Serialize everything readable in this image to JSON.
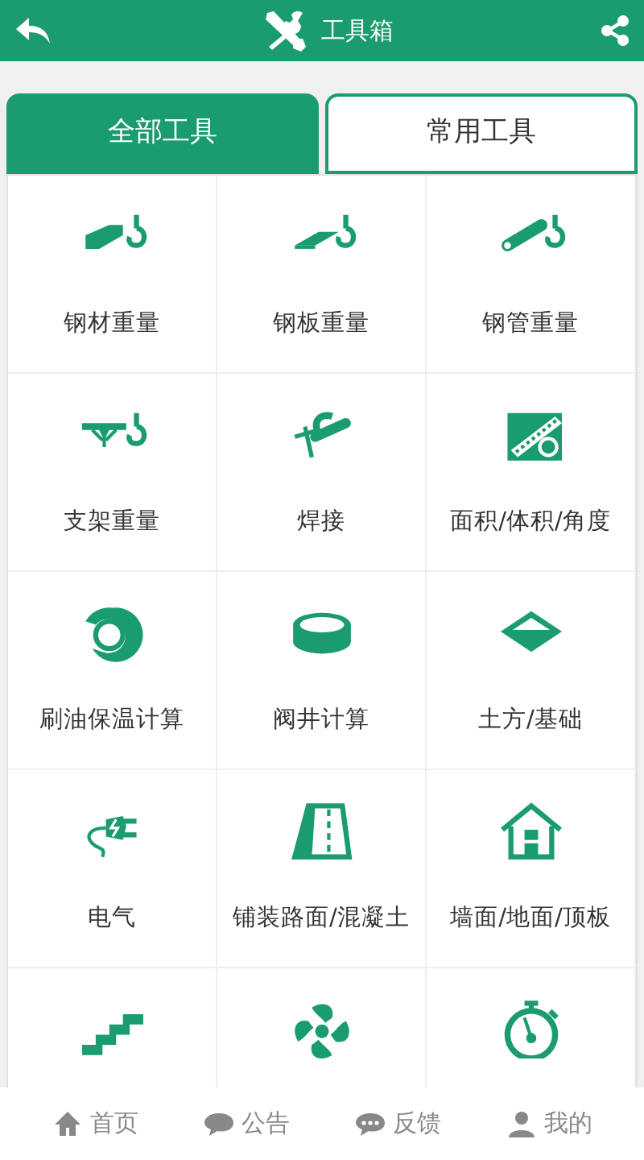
{
  "header": {
    "title": "工具箱"
  },
  "tabs": [
    {
      "label": "全部工具",
      "selected": true
    },
    {
      "label": "常用工具",
      "selected": false
    }
  ],
  "tools": [
    {
      "kind": "tool",
      "label": "钢材重量"
    },
    {
      "kind": "tool",
      "label": "钢板重量"
    },
    {
      "kind": "tool",
      "label": "钢管重量"
    },
    {
      "kind": "tool",
      "label": "支架重量"
    },
    {
      "kind": "tool",
      "label": "焊接"
    },
    {
      "kind": "tool",
      "label": "面积/体积/角度"
    },
    {
      "kind": "tool",
      "label": "刷油保温计算"
    },
    {
      "kind": "tool",
      "label": "阀井计算"
    },
    {
      "kind": "tool",
      "label": "土方/基础"
    },
    {
      "kind": "tool",
      "label": "电气"
    },
    {
      "kind": "tool",
      "label": "铺装路面/混凝土"
    },
    {
      "kind": "tool",
      "label": "墙面/地面/顶板"
    },
    {
      "kind": "icon_only"
    },
    {
      "kind": "icon_only"
    },
    {
      "kind": "icon_only"
    }
  ],
  "bottom_nav": [
    {
      "label": "首页"
    },
    {
      "label": "公告"
    },
    {
      "label": "反馈"
    },
    {
      "label": "我的"
    }
  ]
}
